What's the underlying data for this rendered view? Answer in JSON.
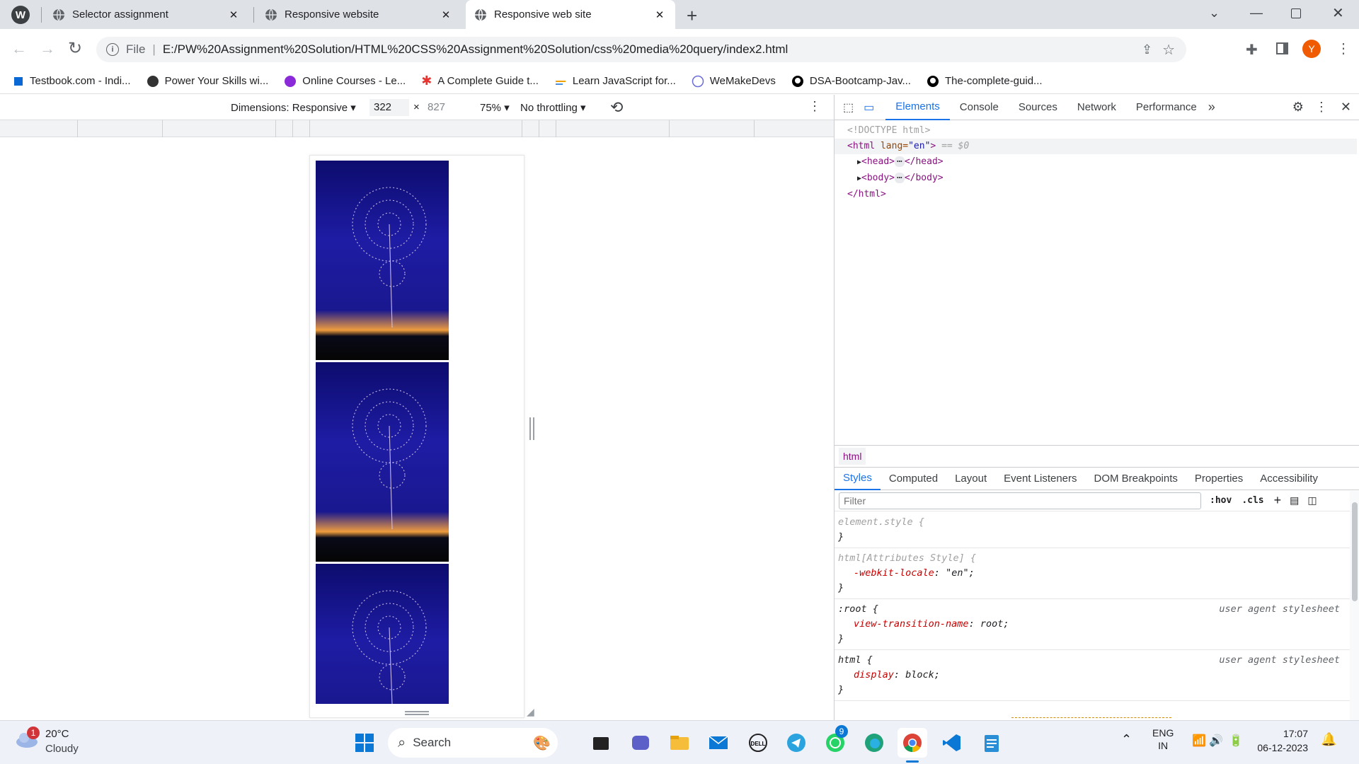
{
  "tabs": [
    {
      "title": "Selector assignment",
      "active": false
    },
    {
      "title": "Responsive website",
      "active": false
    },
    {
      "title": "Responsive web site",
      "active": true
    }
  ],
  "toolbar": {
    "file_label": "File",
    "url": "E:/PW%20Assignment%20Solution/HTML%20CSS%20Assignment%20Solution/css%20media%20query/index2.html",
    "profile_initial": "Y"
  },
  "bookmarks": [
    {
      "label": "Testbook.com - Indi...",
      "icon": "testbook-icon",
      "color": "#0a68d4"
    },
    {
      "label": "Power Your Skills wi...",
      "icon": "wordpress-icon",
      "color": "#333333"
    },
    {
      "label": "Online Courses - Le...",
      "icon": "udemy-icon",
      "color": "#8b2ad8"
    },
    {
      "label": "A Complete Guide t...",
      "icon": "star-burst-icon",
      "color": "#e8332f"
    },
    {
      "label": "Learn JavaScript for...",
      "icon": "js-lines-icon",
      "color": "#f0a000"
    },
    {
      "label": "WeMakeDevs",
      "icon": "globe-icon",
      "color": "#6c6cd8"
    },
    {
      "label": "DSA-Bootcamp-Jav...",
      "icon": "github-icon",
      "color": "#000000"
    },
    {
      "label": "The-complete-guid...",
      "icon": "github-icon",
      "color": "#000000"
    }
  ],
  "device": {
    "dimensions": "Dimensions: Responsive",
    "width": "322",
    "height": "827",
    "times": "×",
    "zoom": "75%",
    "throttling": "No throttling"
  },
  "devtools": {
    "tabs": [
      "Elements",
      "Console",
      "Sources",
      "Network",
      "Performance"
    ],
    "active_tab": "Elements",
    "doctype": "<!DOCTYPE html>",
    "html_open_tag": "<html",
    "html_attr": " lang=",
    "html_attr_val": "\"en\"",
    "html_close_bracket": ">",
    "selected_marker": " == $0",
    "head_open": "<head>",
    "head_close": "</head>",
    "body_open": "<body>",
    "body_close": "</body>",
    "html_close": "</html>",
    "breadcrumb": "html",
    "subtabs": [
      "Styles",
      "Computed",
      "Layout",
      "Event Listeners",
      "DOM Breakpoints",
      "Properties",
      "Accessibility"
    ],
    "filter_placeholder": "Filter",
    "hov": ":hov",
    "cls": ".cls",
    "rules": [
      {
        "selector": "element.style {",
        "decls": [],
        "source": ""
      },
      {
        "selector": "html[Attributes Style] {",
        "decls": [
          {
            "prop": "-webkit-locale",
            "val": "\"en\";"
          }
        ],
        "source": ""
      },
      {
        "selector": ":root {",
        "decls": [
          {
            "prop": "view-transition-name",
            "val": "root;"
          }
        ],
        "source": "user agent stylesheet"
      },
      {
        "selector": "html {",
        "decls": [
          {
            "prop": "display",
            "val": "block;"
          }
        ],
        "source": "user agent stylesheet"
      }
    ],
    "close_brace": "}"
  },
  "taskbar": {
    "weather_temp": "20°C",
    "weather_desc": "Cloudy",
    "weather_badge": "1",
    "search": "Search",
    "whatsapp_badge": "9",
    "lang1": "ENG",
    "lang2": "IN",
    "time": "17:07",
    "date": "06-12-2023"
  }
}
